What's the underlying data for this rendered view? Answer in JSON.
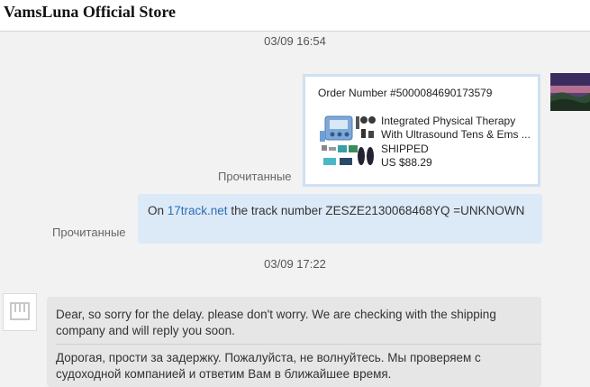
{
  "header": {
    "store_name": "VamsLuna Official Store"
  },
  "messages": {
    "timestamp_1": "03/09 16:54",
    "timestamp_2": "03/09 17:22",
    "order_card": {
      "order_number": "Order Number #5000084690173579",
      "product_title": "Integrated Physical Therapy With Ultrasound Tens & Ems ...",
      "status": "SHIPPED",
      "price": "US $88.29"
    },
    "read_label_1": "Прочитанные",
    "read_label_2": "Прочитанные",
    "track_message": {
      "prefix": "On ",
      "link_text": "17track.net",
      "suffix": " the track number ZESZE2130068468YQ =UNKNOWN"
    },
    "reply": {
      "english": "Dear, so sorry for the delay. please don't worry. We are checking with the shipping company and will reply you soon.",
      "russian": "Дорогая, прости за задержку. Пожалуйста, не волнуйтесь. Мы проверяем с судоходной компанией и ответим Вам в ближайшее время."
    }
  },
  "colors": {
    "background": "#f2f2f2",
    "user_bubble": "#dce9f7",
    "store_bubble": "#e6e6e6",
    "link": "#2e6fb5",
    "card_border": "#cfe0f2"
  },
  "icons": {
    "user_avatar": "user-avatar-landscape",
    "store_avatar": "store-logo-icon",
    "product_image": "therapy-device-product-image"
  }
}
